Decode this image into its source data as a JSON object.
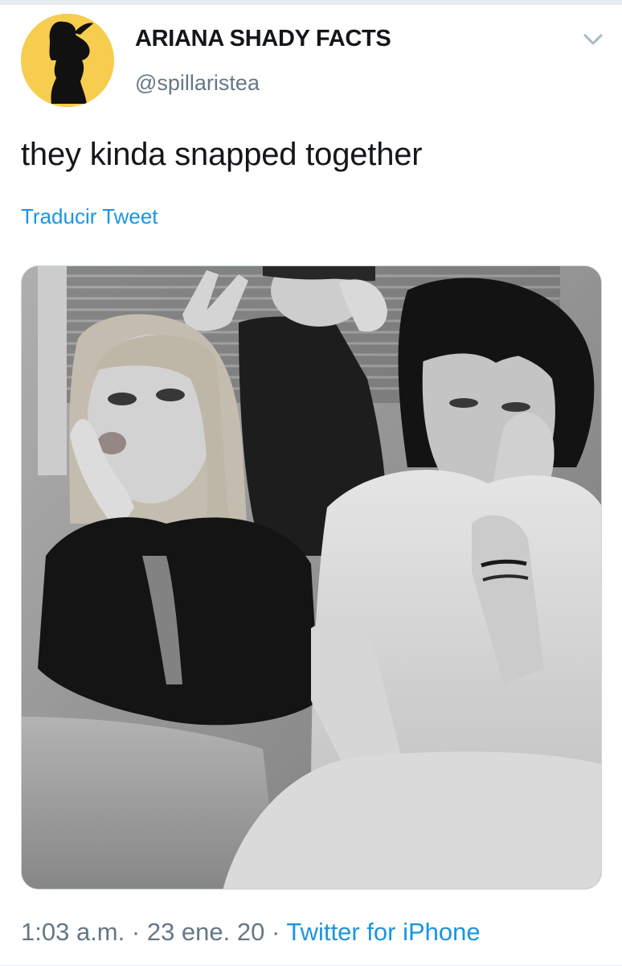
{
  "tweet": {
    "author": {
      "display_name": "ARIANA SHADY FACTS",
      "handle": "@spillaristea",
      "avatar_bg": "#f6cd4f"
    },
    "text": "they kinda snapped together",
    "translate_label": "Traducir Tweet",
    "time": "1:03 a.m.",
    "separator": "·",
    "date": "23 ene. 20",
    "source": "Twitter for iPhone",
    "menu_icon": "chevron-down-icon"
  },
  "colors": {
    "link": "#1b95e0",
    "secondary_text": "#657786",
    "primary_text": "#14171a"
  }
}
